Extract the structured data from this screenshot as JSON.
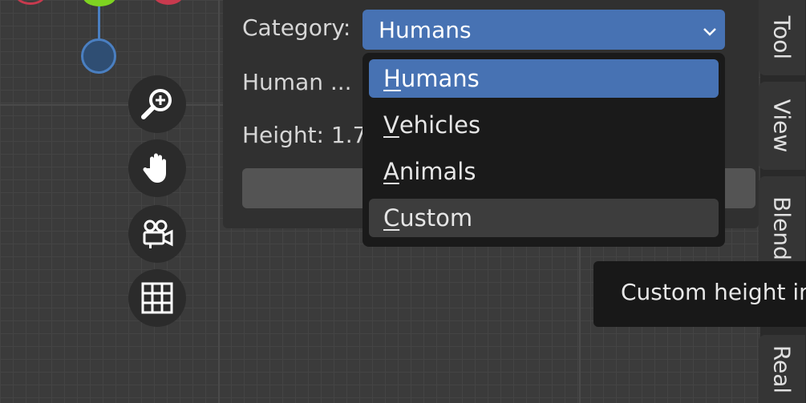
{
  "panel": {
    "category_label": "Category:",
    "human_label": "Human ...",
    "height_label": "Height: 1.7"
  },
  "category_select": {
    "value": "Humans",
    "options": [
      {
        "label": "Humans",
        "mnemonic": "H",
        "rest": "umans",
        "state": "selected"
      },
      {
        "label": "Vehicles",
        "mnemonic": "V",
        "rest": "ehicles",
        "state": "normal"
      },
      {
        "label": "Animals",
        "mnemonic": "A",
        "rest": "nimals",
        "state": "normal"
      },
      {
        "label": "Custom",
        "mnemonic": "C",
        "rest": "ustom",
        "state": "hovered"
      }
    ]
  },
  "sidebar_tabs": [
    "Tool",
    "View",
    "Blend",
    "Real"
  ],
  "tooltip": {
    "text": "Custom height in"
  },
  "nav_icons": [
    "zoom-icon",
    "pan-hand-icon",
    "camera-icon",
    "grid-icon"
  ],
  "colors": {
    "accent": "#4772b3",
    "gizmo_red": "#c83a4e",
    "gizmo_green": "#7ed321",
    "gizmo_blue": "#4a7fc1"
  }
}
